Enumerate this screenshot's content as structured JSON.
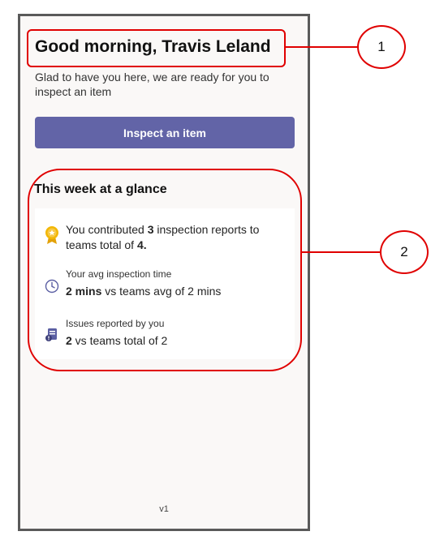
{
  "header": {
    "greeting": "Good morning, Travis Leland",
    "subtitle": "Glad to have you here, we are ready for you to inspect an item"
  },
  "actions": {
    "inspect_label": "Inspect an item"
  },
  "glance": {
    "title": "This week at a glance",
    "contributions": {
      "prefix": "You contributed ",
      "count": "3",
      "middle": " inspection reports to teams total of ",
      "team_total": "4."
    },
    "avg_time": {
      "label": "Your avg inspection time",
      "value": "2 mins",
      "suffix": " vs teams avg of 2 mins"
    },
    "issues": {
      "label": "Issues reported by you",
      "value": "2",
      "suffix": " vs teams total of 2"
    }
  },
  "footer": {
    "version": "v1"
  },
  "annotations": {
    "callout_1": "1",
    "callout_2": "2"
  },
  "colors": {
    "accent": "#6264a7",
    "annotation": "#e00000",
    "badge_gold": "#f2b705"
  }
}
